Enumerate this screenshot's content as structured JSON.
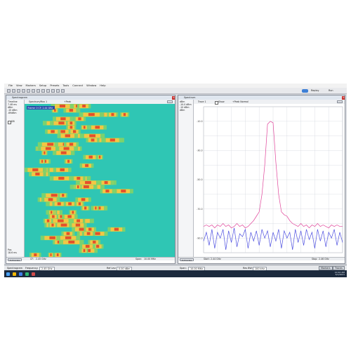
{
  "menubar": {
    "items": [
      "File",
      "View",
      "Markers",
      "Setup",
      "Presets",
      "Tools",
      "Connect",
      "Window",
      "Help"
    ]
  },
  "toolbar": {
    "replay_label": "Replay",
    "run_label": "Run"
  },
  "left_panel": {
    "title": "Spectrogram",
    "top_row": {
      "spectrum_label": "Spectrum/Max 1",
      "detector_label": "+Peak"
    },
    "side_labels": [
      "Timeline",
      "7.48 ms",
      "dBm",
      "-10 dBm",
      "-69dBm"
    ],
    "db_label": "DB",
    "pos_labels": [
      "Pos",
      "18.6 ms"
    ],
    "chart_overlay_label": "Frame: 0  CF: 2.44 GHz",
    "footer": {
      "autoscale_label": "Autoscale",
      "start_label": "CF:",
      "start_value": "2.45 GHz",
      "span_label": "Span:",
      "span_value": "10.00 MHz"
    }
  },
  "right_panel": {
    "title": "Spectrum",
    "top_row": {
      "trace_label": "Trace 1",
      "show_label": "Show",
      "detector_label": "+Peak Normal"
    },
    "side_labels": [
      "dBm",
      "-10.0 dBm",
      "-10 dBm",
      "dBm"
    ],
    "footer": {
      "autoscale_label": "Autoscale",
      "start_label": "Start:",
      "start_value": "2.44 GHz",
      "stop_label": "Stop:",
      "stop_value": "2.46 GHz"
    }
  },
  "statusbar": {
    "mode_label": "Spectrogram",
    "frequency_label": "Frequency:",
    "frequency_value": "2.45 GHz",
    "ref_label": "Ref Lev:",
    "ref_value": "0.00 dBm",
    "span_label": "Span:",
    "span_value": "10.00 MHz",
    "rbw_label": "Res BW:",
    "rbw_value": "100 kHz",
    "markers_button": "Markers",
    "traces_button": "Traces"
  },
  "taskbar": {
    "time": "10:10 AM",
    "date": "3/1/2021"
  },
  "colors": {
    "trace_max": "#e0459a",
    "trace_live": "#4d4fe0",
    "spectrogram_bg": "#2fc6b4",
    "title_bar": "#dfe6ef",
    "taskbar": "#1c2a3d"
  },
  "chart_data": {
    "type": "line",
    "title": "",
    "xlabel": "",
    "ylabel": "",
    "y_ticks": [
      -10,
      -30,
      -50,
      -70,
      -90
    ],
    "ylim": [
      -100,
      0
    ],
    "xlim": [
      0,
      1
    ],
    "grid": true,
    "series": [
      {
        "x": [
          0,
          0.02,
          0.04,
          0.06,
          0.08,
          0.1,
          0.12,
          0.14,
          0.16,
          0.18,
          0.2,
          0.22,
          0.24,
          0.26,
          0.28,
          0.3,
          0.32,
          0.34,
          0.36,
          0.38,
          0.4,
          0.42,
          0.44,
          0.46,
          0.48,
          0.5,
          0.52,
          0.54,
          0.56,
          0.58,
          0.6,
          0.62,
          0.64,
          0.66,
          0.68,
          0.7,
          0.72,
          0.74,
          0.76,
          0.78,
          0.8,
          0.82,
          0.84,
          0.86,
          0.88,
          0.9,
          0.92,
          0.94,
          0.96,
          0.98,
          1.0
        ],
        "values": [
          -82,
          -81,
          -82,
          -81,
          -83,
          -81,
          -82,
          -80,
          -82,
          -81,
          -83,
          -82,
          -80,
          -82,
          -81,
          -83,
          -82,
          -80,
          -78,
          -75,
          -72,
          -60,
          -40,
          -12,
          -10,
          -11,
          -38,
          -60,
          -72,
          -74,
          -75,
          -78,
          -80,
          -81,
          -82,
          -80,
          -82,
          -81,
          -83,
          -81,
          -82,
          -80,
          -82,
          -81,
          -82,
          -83,
          -81,
          -82,
          -81,
          -82,
          -82
        ]
      },
      {
        "x": [
          0,
          0.02,
          0.04,
          0.06,
          0.08,
          0.1,
          0.12,
          0.14,
          0.16,
          0.18,
          0.2,
          0.22,
          0.24,
          0.26,
          0.28,
          0.3,
          0.32,
          0.34,
          0.36,
          0.38,
          0.4,
          0.42,
          0.44,
          0.46,
          0.48,
          0.5,
          0.52,
          0.54,
          0.56,
          0.58,
          0.6,
          0.62,
          0.64,
          0.66,
          0.68,
          0.7,
          0.72,
          0.74,
          0.76,
          0.78,
          0.8,
          0.82,
          0.84,
          0.86,
          0.88,
          0.9,
          0.92,
          0.94,
          0.96,
          0.98,
          1.0
        ],
        "values": [
          -92,
          -86,
          -95,
          -84,
          -97,
          -86,
          -90,
          -84,
          -98,
          -85,
          -93,
          -83,
          -96,
          -87,
          -89,
          -84,
          -97,
          -86,
          -92,
          -85,
          -95,
          -84,
          -90,
          -85,
          -96,
          -86,
          -92,
          -84,
          -97,
          -85,
          -90,
          -86,
          -98,
          -84,
          -93,
          -85,
          -95,
          -84,
          -91,
          -86,
          -97,
          -84,
          -92,
          -85,
          -96,
          -86,
          -90,
          -84,
          -95,
          -86,
          -93
        ]
      }
    ]
  }
}
